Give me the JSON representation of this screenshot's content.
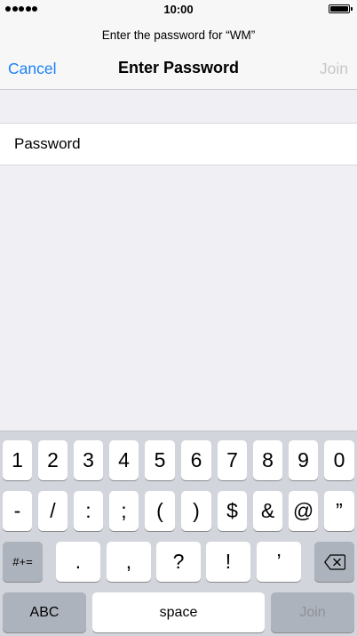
{
  "status_bar": {
    "time": "10:00",
    "signal_dots": 5
  },
  "header": {
    "prompt": "Enter the password for “WM”",
    "title": "Enter Password",
    "cancel_label": "Cancel",
    "join_label": "Join"
  },
  "form": {
    "password_label": "Password",
    "password_value": ""
  },
  "keyboard": {
    "row1": [
      "1",
      "2",
      "3",
      "4",
      "5",
      "6",
      "7",
      "8",
      "9",
      "0"
    ],
    "row2": [
      "-",
      "/",
      ":",
      ";",
      "(",
      ")",
      "$",
      "&",
      "@",
      "”"
    ],
    "row3": [
      ".",
      ",",
      "?",
      "!",
      "’"
    ],
    "symbols_key": "#+=",
    "abc_key": "ABC",
    "space_key": "space",
    "join_key": "Join",
    "backspace_icon": "backspace-icon"
  },
  "colors": {
    "accent": "#1a82f7",
    "disabled_text": "#c7c7cc",
    "keyboard_bg": "#d2d5db",
    "dark_key": "#adb3bc"
  }
}
